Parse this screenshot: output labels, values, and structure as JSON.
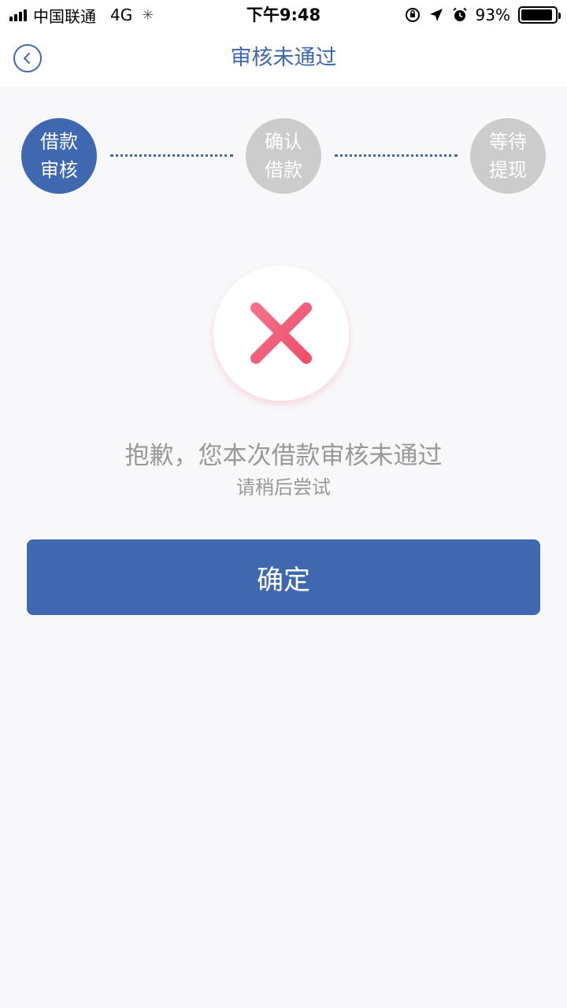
{
  "status_bar": {
    "carrier": "中国联通",
    "network": "4G",
    "time": "下午9:48",
    "battery": "93%",
    "battery_level": 0.93
  },
  "nav": {
    "title": "审核未通过",
    "back_icon": "chevron-left-icon"
  },
  "steps": [
    {
      "label": "借款审核",
      "line1": "借款",
      "line2": "审核",
      "active": true
    },
    {
      "label": "确认借款",
      "line1": "确认",
      "line2": "借款",
      "active": false
    },
    {
      "label": "等待提现",
      "line1": "等待",
      "line2": "提现",
      "active": false
    }
  ],
  "result": {
    "icon": "close-icon",
    "message": "抱歉，您本次借款审核未通过",
    "sub_message": "请稍后尝试"
  },
  "actions": {
    "confirm_label": "确定"
  },
  "colors": {
    "primary": "#3f68b1",
    "inactive_step": "#cccccc",
    "error": "#f0506e",
    "background": "#f8f8fb",
    "muted_text": "#999999"
  }
}
